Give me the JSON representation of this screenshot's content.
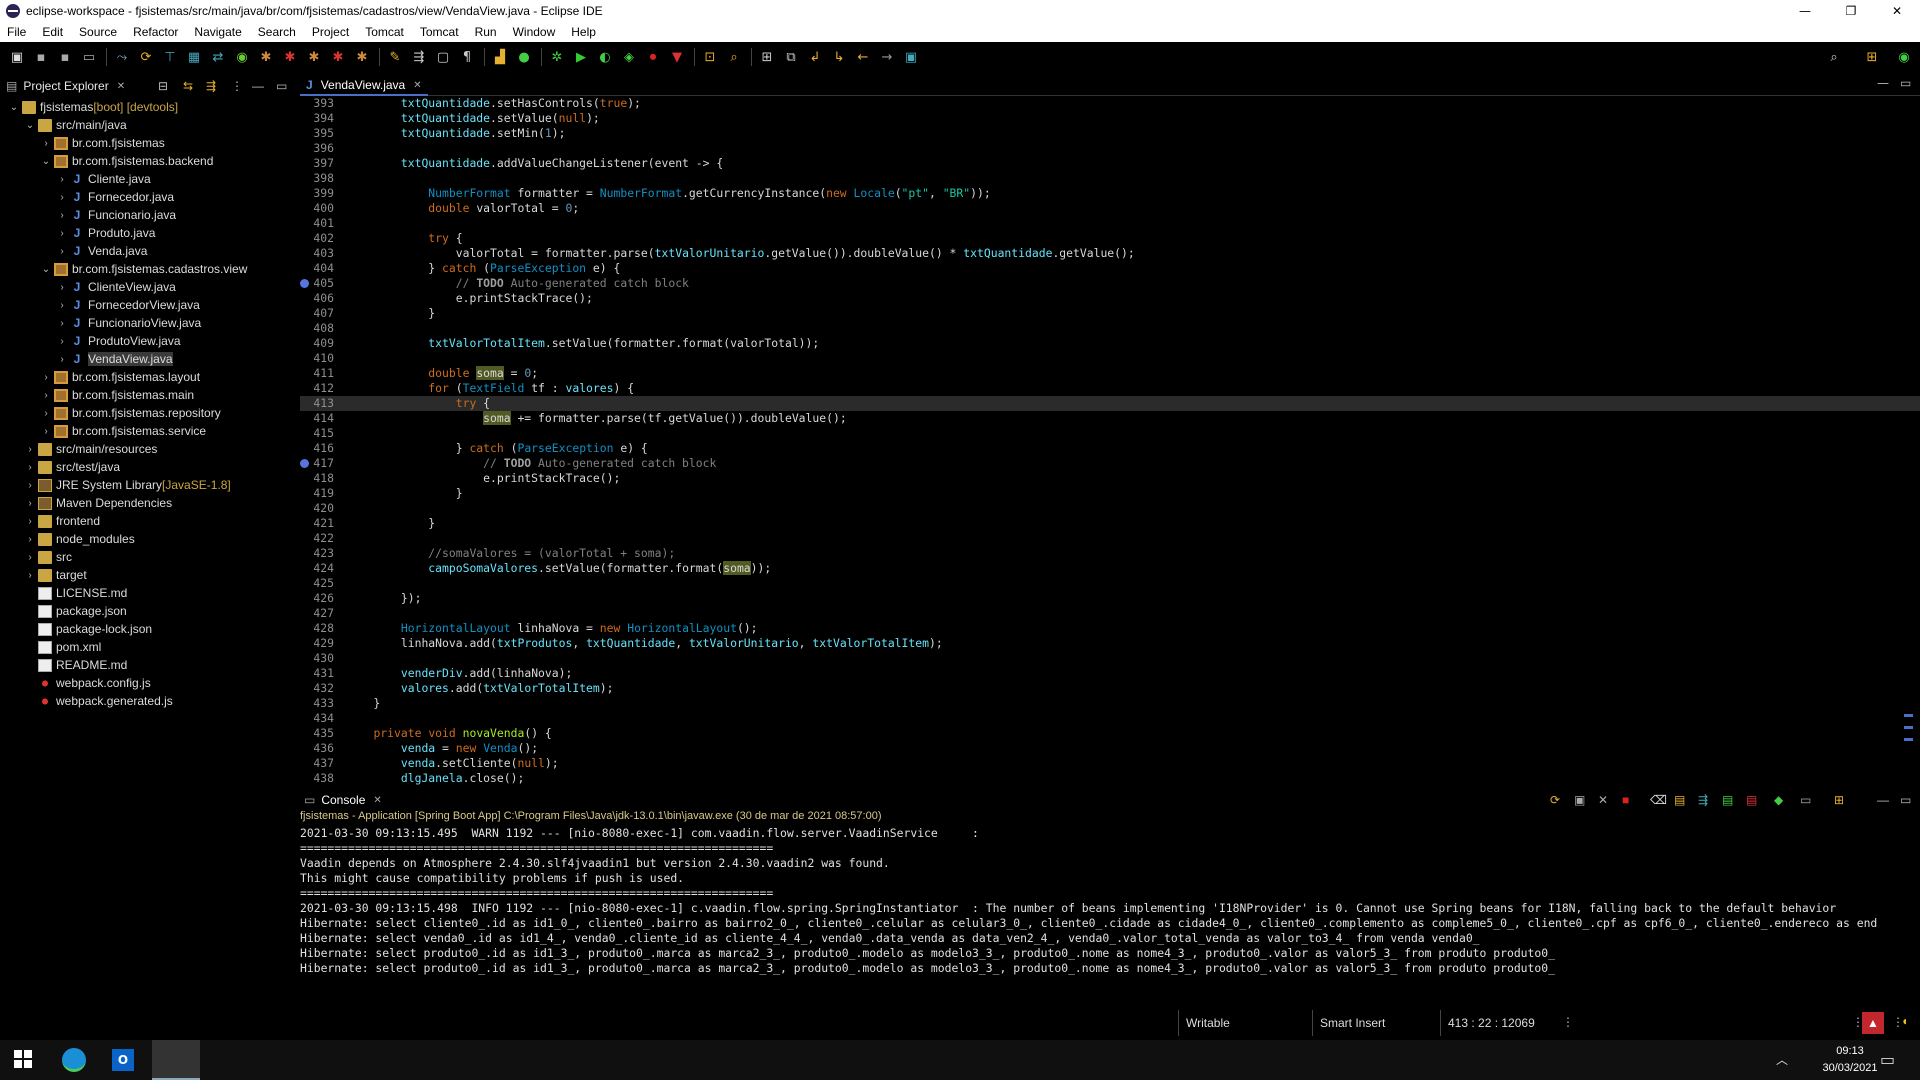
{
  "window": {
    "title": "eclipse-workspace - fjsistemas/src/main/java/br/com/fjsistemas/cadastros/view/VendaView.java - Eclipse IDE",
    "minimize": "—",
    "maximize": "❐",
    "close": "✕"
  },
  "menu": [
    "File",
    "Edit",
    "Source",
    "Refactor",
    "Navigate",
    "Search",
    "Project",
    "Tomcat",
    "Tomcat",
    "Run",
    "Window",
    "Help"
  ],
  "explorer": {
    "tab_label": "Project Explorer",
    "items": [
      {
        "label": "fjsistemas",
        "deco": " [boot] [devtools]"
      },
      {
        "label": "src/main/java"
      },
      {
        "label": "br.com.fjsistemas"
      },
      {
        "label": "br.com.fjsistemas.backend"
      },
      {
        "label": "Cliente.java"
      },
      {
        "label": "Fornecedor.java"
      },
      {
        "label": "Funcionario.java"
      },
      {
        "label": "Produto.java"
      },
      {
        "label": "Venda.java"
      },
      {
        "label": "br.com.fjsistemas.cadastros.view"
      },
      {
        "label": "ClienteView.java"
      },
      {
        "label": "FornecedorView.java"
      },
      {
        "label": "FuncionarioView.java"
      },
      {
        "label": "ProdutoView.java"
      },
      {
        "label": "VendaView.java"
      },
      {
        "label": "br.com.fjsistemas.layout"
      },
      {
        "label": "br.com.fjsistemas.main"
      },
      {
        "label": "br.com.fjsistemas.repository"
      },
      {
        "label": "br.com.fjsistemas.service"
      },
      {
        "label": "src/main/resources"
      },
      {
        "label": "src/test/java"
      },
      {
        "label": "JRE System Library",
        "deco": " [JavaSE-1.8]"
      },
      {
        "label": "Maven Dependencies"
      },
      {
        "label": "frontend"
      },
      {
        "label": "node_modules"
      },
      {
        "label": "src"
      },
      {
        "label": "target"
      },
      {
        "label": "LICENSE.md"
      },
      {
        "label": "package.json"
      },
      {
        "label": "package-lock.json"
      },
      {
        "label": "pom.xml"
      },
      {
        "label": "README.md"
      },
      {
        "label": "webpack.config.js"
      },
      {
        "label": "webpack.generated.js"
      }
    ]
  },
  "editor": {
    "tab_label": "VendaView.java",
    "line_numbers": [
      "393",
      "394",
      "395",
      "396",
      "397",
      "398",
      "399",
      "400",
      "401",
      "402",
      "403",
      "404",
      "405",
      "406",
      "407",
      "408",
      "409",
      "410",
      "411",
      "412",
      "413",
      "414",
      "415",
      "416",
      "417",
      "418",
      "419",
      "420",
      "421",
      "422",
      "423",
      "424",
      "425",
      "426",
      "427",
      "428",
      "429",
      "430",
      "431",
      "432",
      "433",
      "434",
      "435",
      "436",
      "437",
      "438"
    ],
    "lines": [
      "        txtQuantidade.setHasControls(true);",
      "        txtQuantidade.setValue(null);",
      "        txtQuantidade.setMin(1);",
      "",
      "        txtQuantidade.addValueChangeListener(event -> {",
      "",
      "            NumberFormat formatter = NumberFormat.getCurrencyInstance(new Locale(\"pt\", \"BR\"));",
      "            double valorTotal = 0;",
      "",
      "            try {",
      "                valorTotal = formatter.parse(txtValorUnitario.getValue()).doubleValue() * txtQuantidade.getValue();",
      "            } catch (ParseException e) {",
      "                // TODO Auto-generated catch block",
      "                e.printStackTrace();",
      "            }",
      "",
      "            txtValorTotalItem.setValue(formatter.format(valorTotal));",
      "",
      "            double soma = 0;",
      "            for (TextField tf : valores) {",
      "                try {",
      "                    soma += formatter.parse(tf.getValue()).doubleValue();",
      "",
      "                } catch (ParseException e) {",
      "                    // TODO Auto-generated catch block",
      "                    e.printStackTrace();",
      "                }",
      "",
      "            }",
      "",
      "            //somaValores = (valorTotal + soma);",
      "            campoSomaValores.setValue(formatter.format(soma));",
      "",
      "        });",
      "",
      "        HorizontalLayout linhaNova = new HorizontalLayout();",
      "        linhaNova.add(txtProdutos, txtQuantidade, txtValorUnitario, txtValorTotalItem);",
      "",
      "        venderDiv.add(linhaNova);",
      "        valores.add(txtValorTotalItem);",
      "    }",
      "",
      "    private void novaVenda() {",
      "        venda = new Venda();",
      "        venda.setCliente(null);",
      "        dlgJanela.close();"
    ]
  },
  "console": {
    "tab_label": "Console",
    "launch": "fjsistemas - Application [Spring Boot App] C:\\Program Files\\Java\\jdk-13.0.1\\bin\\javaw.exe  (30 de mar de 2021 08:57:00)",
    "lines": [
      "2021-03-30 09:13:15.495  WARN 1192 --- [nio-8080-exec-1] com.vaadin.flow.server.VaadinService     :",
      "=====================================================================",
      "Vaadin depends on Atmosphere 2.4.30.slf4jvaadin1 but version 2.4.30.vaadin2 was found.",
      "This might cause compatibility problems if push is used.",
      "=====================================================================",
      "2021-03-30 09:13:15.498  INFO 1192 --- [nio-8080-exec-1] c.vaadin.flow.spring.SpringInstantiator  : The number of beans implementing 'I18NProvider' is 0. Cannot use Spring beans for I18N, falling back to the default behavior",
      "Hibernate: select cliente0_.id as id1_0_, cliente0_.bairro as bairro2_0_, cliente0_.celular as celular3_0_, cliente0_.cidade as cidade4_0_, cliente0_.complemento as compleme5_0_, cliente0_.cpf as cpf6_0_, cliente0_.endereco as end",
      "Hibernate: select venda0_.id as id1_4_, venda0_.cliente_id as cliente_4_4_, venda0_.data_venda as data_ven2_4_, venda0_.valor_total_venda as valor_to3_4_ from venda venda0_",
      "Hibernate: select produto0_.id as id1_3_, produto0_.marca as marca2_3_, produto0_.modelo as modelo3_3_, produto0_.nome as nome4_3_, produto0_.valor as valor5_3_ from produto produto0_",
      "Hibernate: select produto0_.id as id1_3_, produto0_.marca as marca2_3_, produto0_.modelo as modelo3_3_, produto0_.nome as nome4_3_, produto0_.valor as valor5_3_ from produto produto0_"
    ]
  },
  "status": {
    "writable": "Writable",
    "insert_mode": "Smart Insert",
    "position": "413 : 22 : 12069"
  },
  "taskbar": {
    "time": "09:13",
    "date": "30/03/2021"
  }
}
